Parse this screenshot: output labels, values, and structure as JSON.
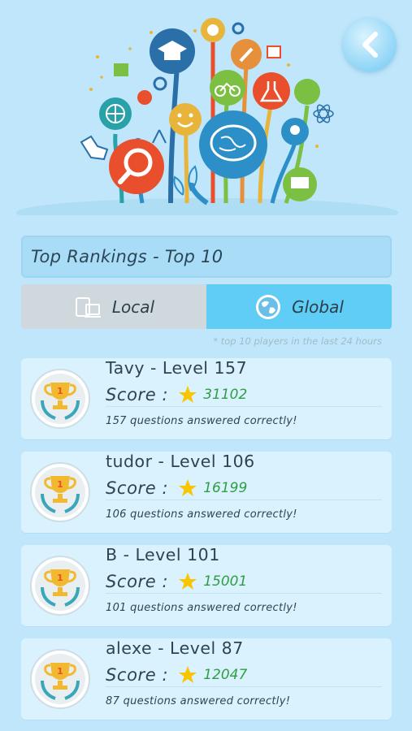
{
  "header": {
    "back_icon": "chevron-left-icon",
    "illustration": "knowledge-tree-illustration"
  },
  "title": "Top Rankings - Top 10",
  "tabs": [
    {
      "label": "Local",
      "icon": "devices-icon",
      "selected": false
    },
    {
      "label": "Global",
      "icon": "globe-icon",
      "selected": true
    }
  ],
  "footnote": "* top 10 players in the last 24 hours",
  "score_label": "Score :",
  "rankings": [
    {
      "name": "Tavy - Level 157",
      "score": "31102",
      "answered": "157 questions answered correctly!"
    },
    {
      "name": "tudor - Level 106",
      "score": "16199",
      "answered": "106 questions answered correctly!"
    },
    {
      "name": "B - Level 101",
      "score": "15001",
      "answered": "101 questions answered correctly!"
    },
    {
      "name": "alexe - Level 87",
      "score": "12047",
      "answered": "87 questions answered correctly!"
    }
  ],
  "colors": {
    "background": "#bfe6fb",
    "selected_tab": "#5fcdf6",
    "unselected_tab": "#cfd8dd",
    "score_value": "#2f9e44"
  }
}
